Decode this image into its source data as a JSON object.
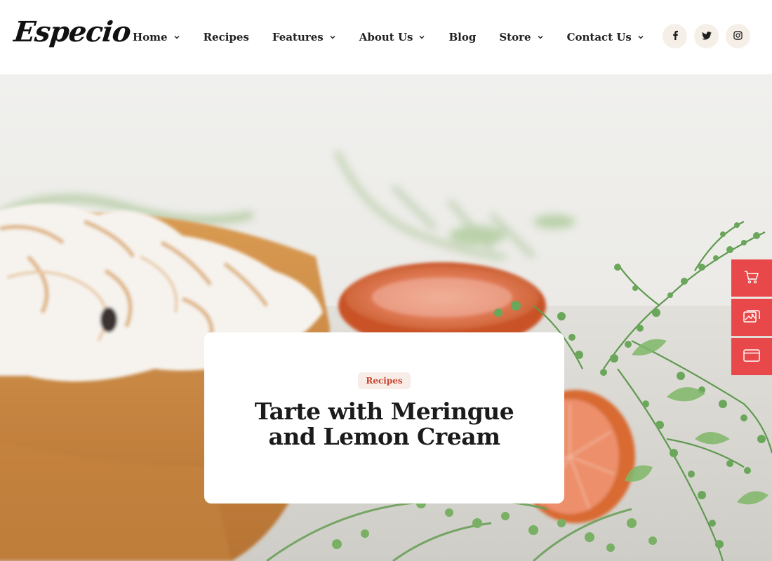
{
  "logo": {
    "text": "Especio"
  },
  "nav": [
    {
      "label": "Home",
      "has_dropdown": true
    },
    {
      "label": "Recipes",
      "has_dropdown": false
    },
    {
      "label": "Features",
      "has_dropdown": true
    },
    {
      "label": "About Us",
      "has_dropdown": true
    },
    {
      "label": "Blog",
      "has_dropdown": false
    },
    {
      "label": "Store",
      "has_dropdown": true
    },
    {
      "label": "Contact Us",
      "has_dropdown": true
    }
  ],
  "socials": [
    {
      "icon": "facebook-icon"
    },
    {
      "icon": "twitter-icon"
    },
    {
      "icon": "instagram-icon"
    }
  ],
  "hero": {
    "category": "Recipes",
    "title": "Tarte with Meringue and Lemon Cream"
  },
  "side_tools": [
    {
      "icon": "cart-icon"
    },
    {
      "icon": "images-icon"
    },
    {
      "icon": "browser-window-icon"
    }
  ],
  "colors": {
    "accent": "#e8484a",
    "badge_bg": "#f8ece6",
    "badge_text": "#c9442f",
    "social_bg": "#f5efe8"
  }
}
